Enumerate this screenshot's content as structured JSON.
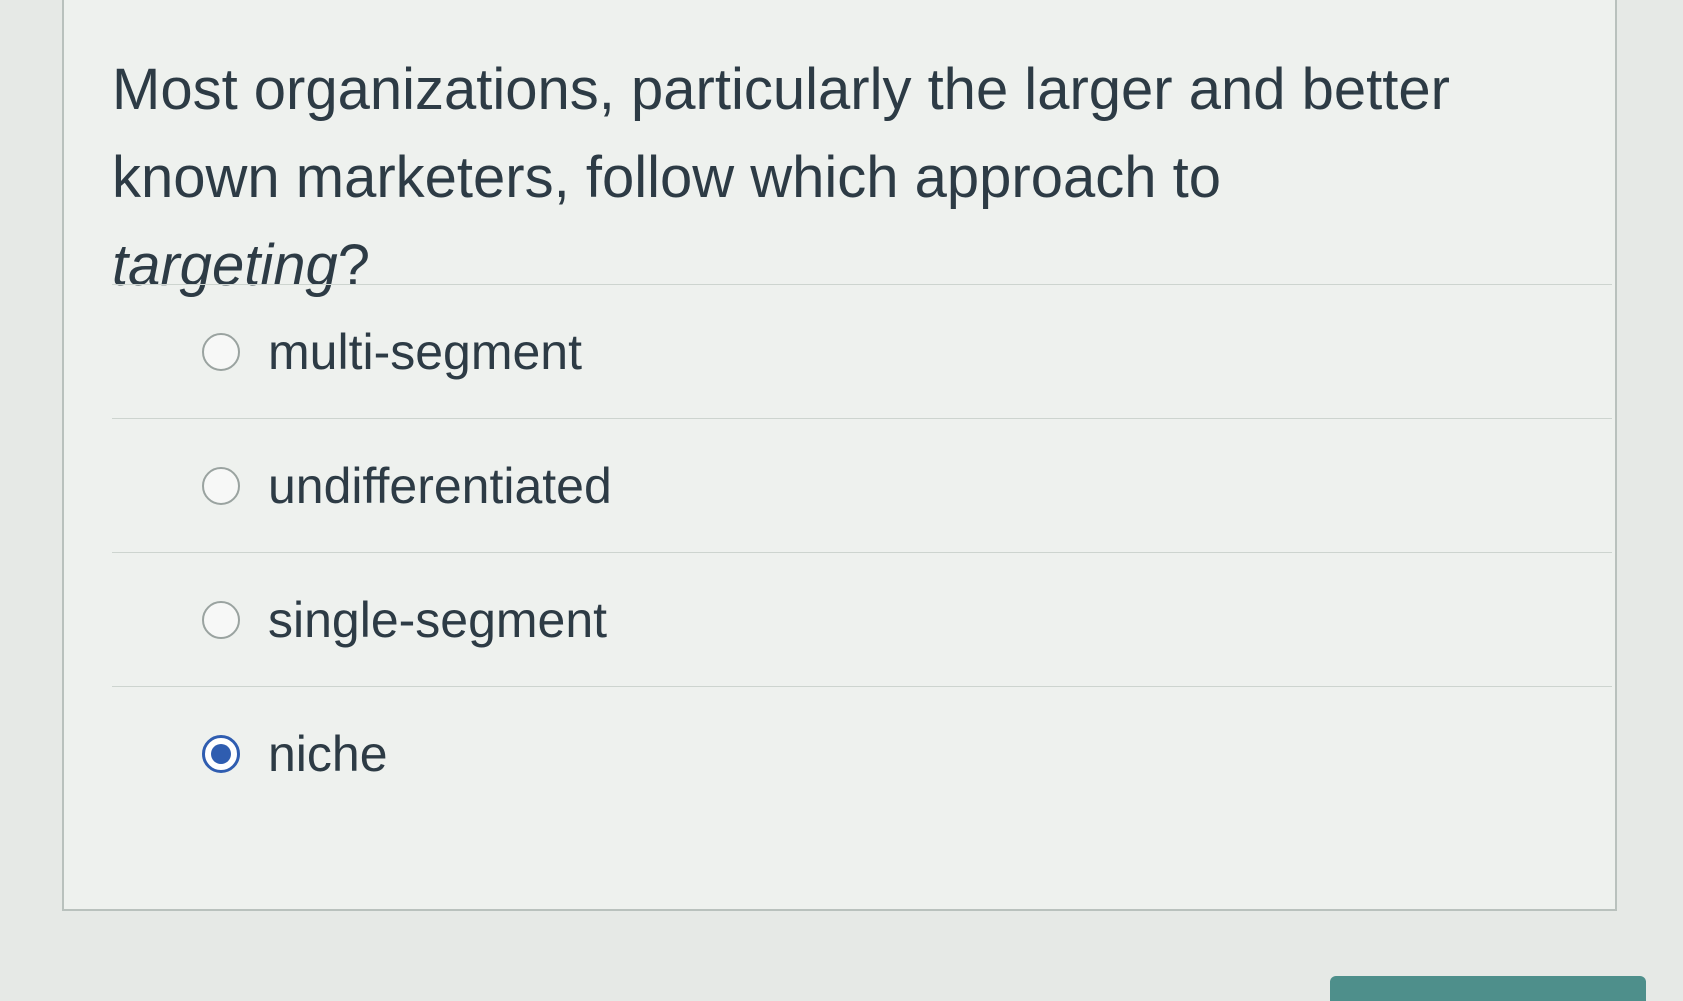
{
  "question": {
    "text_before": "Most organizations, particularly the larger and better known marketers, follow which approach to ",
    "text_emphasis": "targeting",
    "text_after": "?"
  },
  "answers": [
    {
      "label": "multi-segment",
      "selected": false
    },
    {
      "label": "undifferentiated",
      "selected": false
    },
    {
      "label": "single-segment",
      "selected": false
    },
    {
      "label": "niche",
      "selected": true
    }
  ],
  "colors": {
    "accent": "#2f5db0",
    "text": "#2d3b45",
    "button": "#4e8f8b"
  }
}
